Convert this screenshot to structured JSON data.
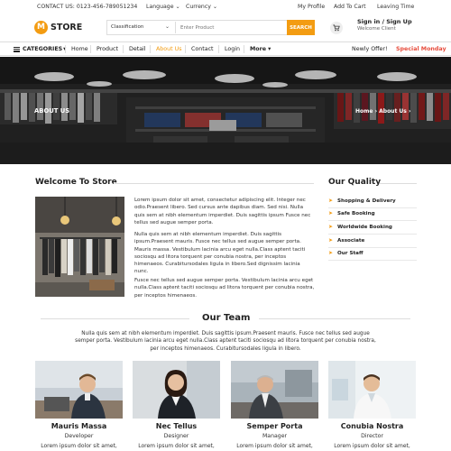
{
  "topbar": {
    "contact": "CONTACT US: 0123-456-789051234",
    "language": "Language",
    "currency": "Currency",
    "my_profile": "My Profile",
    "add_to_cart": "Add To Cart",
    "leaving_time": "Leaving Time"
  },
  "header": {
    "logo_letter": "M",
    "logo_text": "STORE",
    "classification": "Classification",
    "search_placeholder": "Enter Product",
    "search_button": "SEARCH",
    "signin": "Sign in / Sign Up",
    "welcome": "Welcome Client"
  },
  "nav": {
    "categories": "CATEGORIES",
    "items": [
      "Home",
      "Product",
      "Detail",
      "About Us",
      "Contact",
      "Login",
      "More"
    ],
    "active_index": 3,
    "newly_offer": "Newly Offer!",
    "special": "Special Monday"
  },
  "hero": {
    "title": "ABOUT US",
    "breadcrumb_home": "Home",
    "breadcrumb_current": "About Us"
  },
  "welcome": {
    "title": "Welcome To Store",
    "p1": "Lorem ipsum dolor sit amet, consectetur adipiscing elit. Integer nec odio.Praesent libero. Sed cursus ante dapibus diam. Sed nisi. Nulla quis sem at nibh elementum imperdiet. Duis sagittis ipsum Fusce nec tellus sed augue semper porta.",
    "p2": "Nulla quis sem at nibh elementum imperdiet. Duis sagittis ipsum.Praesent mauris. Fusce nec tellus sed augue semper porta. Mauris massa. Vestibulum lacinia arcu eget nulla.Class aptent taciti sociosqu ad litora torquent per conubia nostra, per inceptos himenaeos. Curabitursodales ligula in libero.Sed dignissim lacinia nunc.",
    "p3": "Fusce nec tellus sed augue semper porta. Vestibulum lacinia arcu eget nulla.Class aptent taciti sociosqu ad litora torquent per conubia nostra, per inceptos himenaeos."
  },
  "quality": {
    "title": "Our Quality",
    "items": [
      "Shopping & Delivery",
      "Safe Booking",
      "Worldwide Booking",
      "Associate",
      "Our Staff"
    ]
  },
  "team": {
    "title": "Our Team",
    "intro": "Nulla quis sem at nibh elementum imperdiet. Duis sagittis ipsum.Praesent mauris. Fusce nec tellus sed augue semper porta. Vestibulum lacinia arcu eget nulla.Class aptent taciti sociosqu ad litora torquent per conubia nostra, per inceptos himenaeos. Curabitursodales ligula in libero.",
    "members": [
      {
        "name": "Mauris Massa",
        "role": "Developer",
        "desc": "Lorem ipsum dolor sit amet,"
      },
      {
        "name": "Nec Tellus",
        "role": "Designer",
        "desc": "Lorem ipsum dolor sit amet,"
      },
      {
        "name": "Semper Porta",
        "role": "Manager",
        "desc": "Lorem ipsum dolor sit amet,"
      },
      {
        "name": "Conubia Nostra",
        "role": "Director",
        "desc": "Lorem ipsum dolor sit amet,"
      }
    ]
  },
  "colors": {
    "accent": "#f39c12",
    "special": "#e74c3c",
    "text": "#222222"
  }
}
